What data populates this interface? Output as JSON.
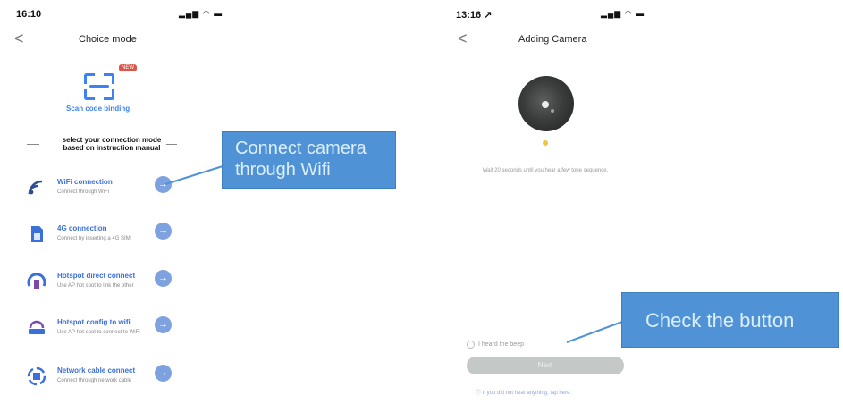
{
  "left": {
    "status_time": "16:10",
    "status_icons": "▂▄▆ ◠ ▬",
    "back_icon": "<",
    "title": "Choice mode",
    "scan": {
      "badge": "NEW",
      "label": "Scan code binding"
    },
    "section_label_line1": "select your connection mode",
    "section_label_line2": "based on instruction manual",
    "modes": [
      {
        "icon": "wifi-icon",
        "title": "WiFi connection",
        "subtitle": "Connect through WiFi"
      },
      {
        "icon": "sim-card-icon",
        "title": "4G connection",
        "subtitle": "Connect by inserting a 4G SIM"
      },
      {
        "icon": "hotspot-icon",
        "title": "Hotspot direct connect",
        "subtitle": "Use AP hot spot to link the other"
      },
      {
        "icon": "router-icon",
        "title": "Hotspot config to wifi",
        "subtitle": "Use AP hot spot to connect to WiFi"
      },
      {
        "icon": "network-cable-icon",
        "title": "Network cable connect",
        "subtitle": "Connect through network cable"
      }
    ],
    "go_icon": "→"
  },
  "right": {
    "status_time": "13:16 ↗",
    "status_icons": "▂▄▆ ◠ ▬",
    "back_icon": "<",
    "title": "Adding Camera",
    "wait_text": "Wait 20 seconds until you hear a few tone sequence.",
    "heard_label": "I heard the beep",
    "next_label": "Next",
    "hint": "ⓘ If you did not hear anything, tap here."
  },
  "callouts": {
    "left": "Connect camera through Wifi",
    "right": "Check the button"
  },
  "colors": {
    "accent": "#3b82f6",
    "callout": "#4f93d6",
    "badge": "#e0554a"
  }
}
